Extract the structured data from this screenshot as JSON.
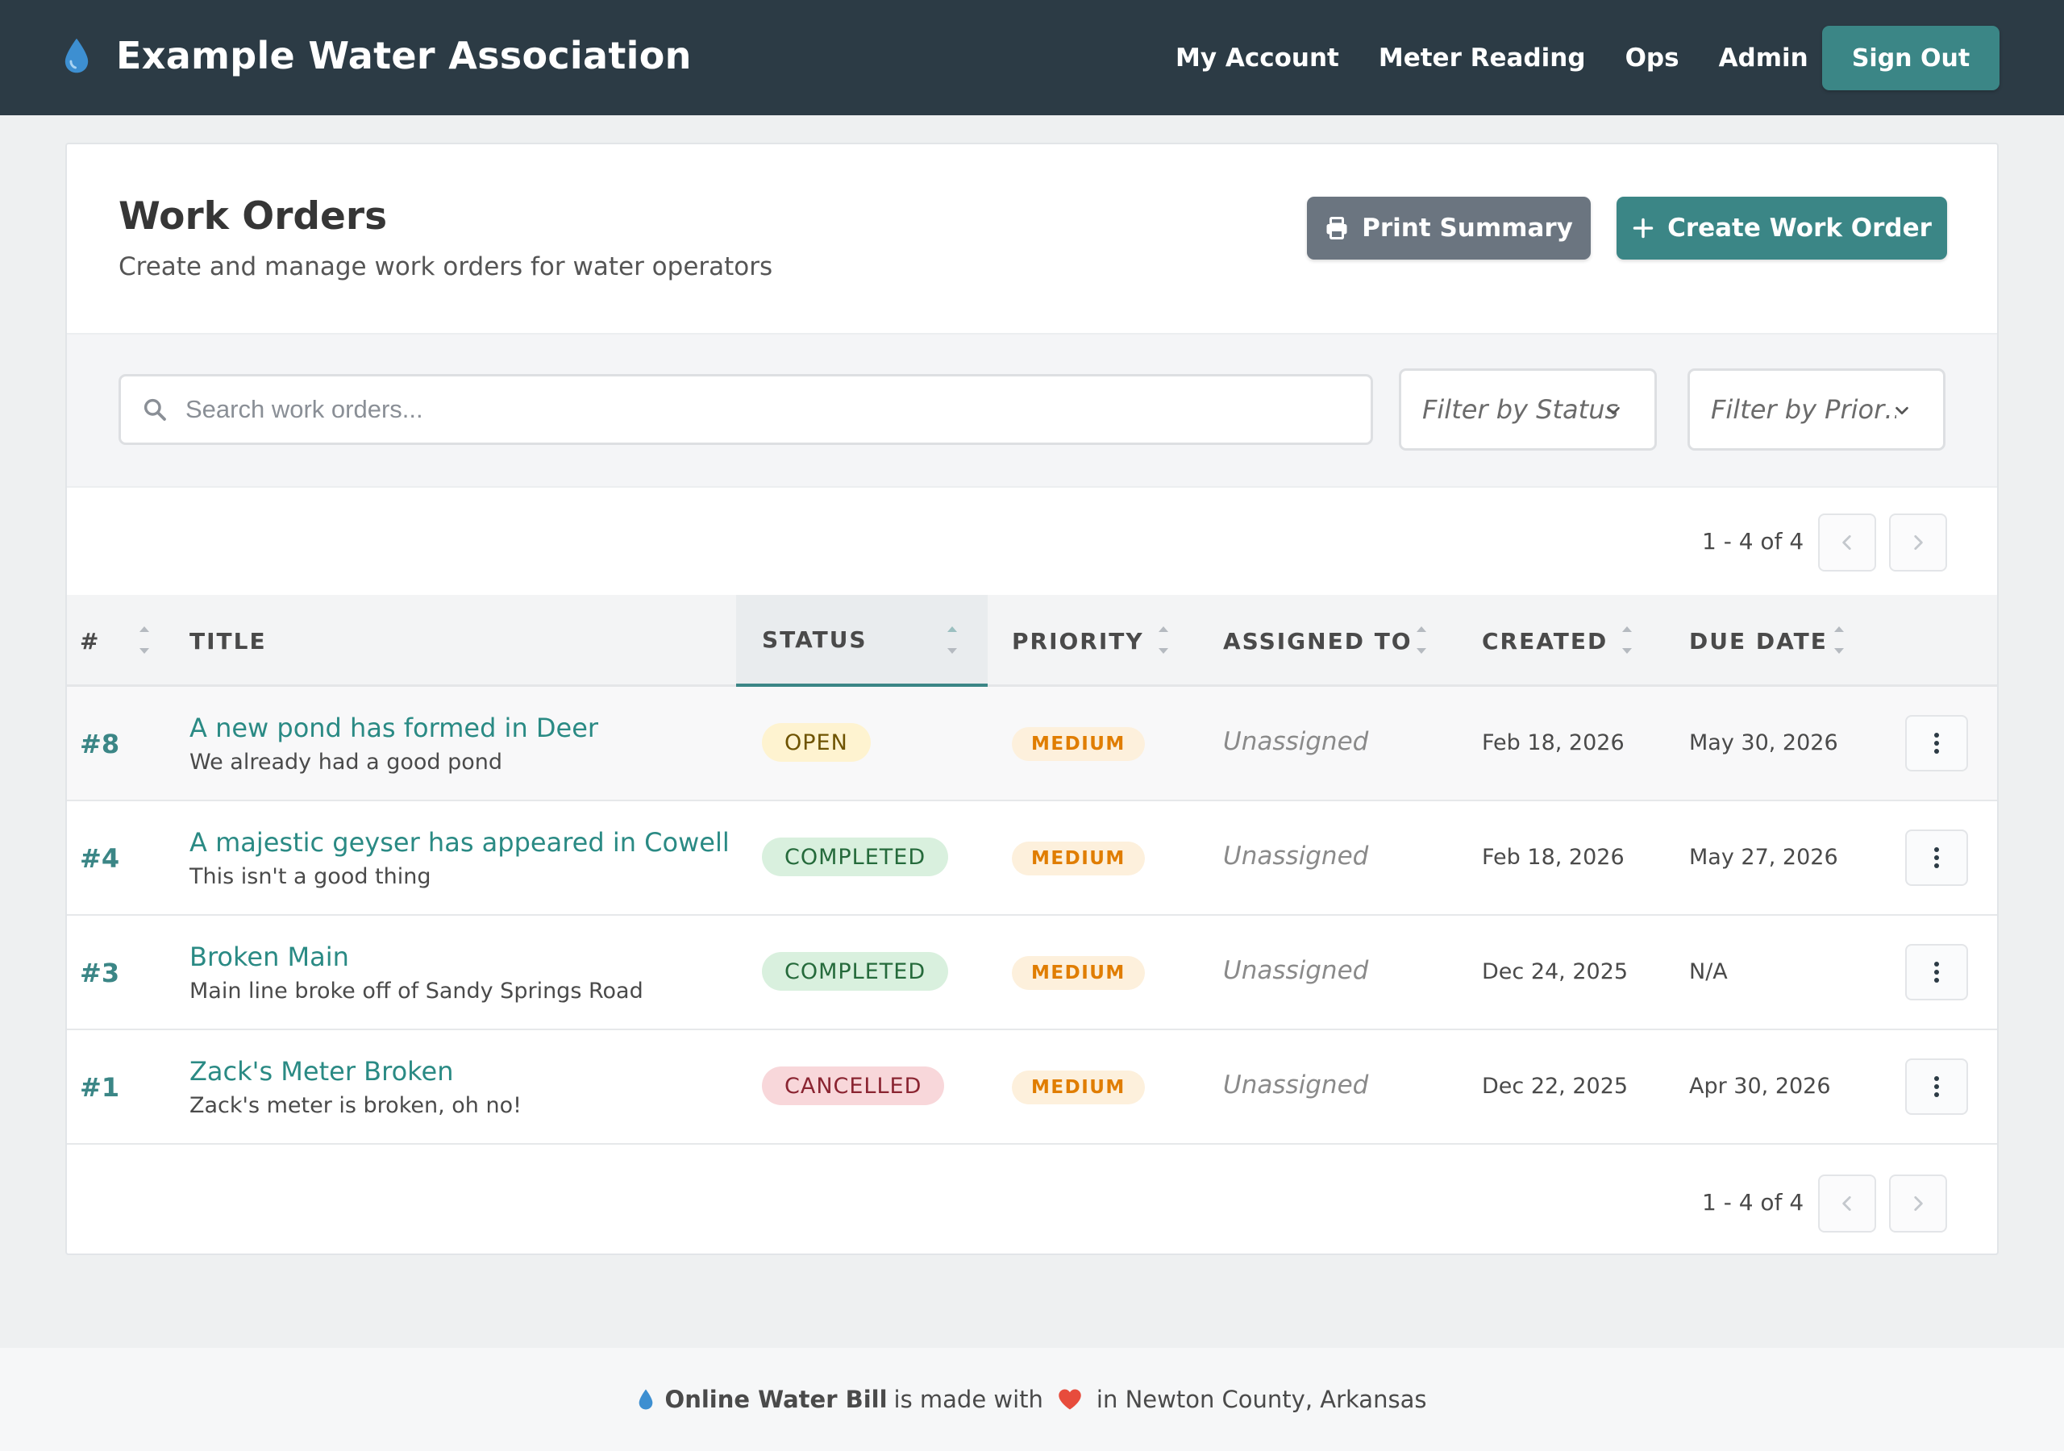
{
  "navbar": {
    "brand_title": "Example Water Association",
    "links": [
      {
        "label": "My Account"
      },
      {
        "label": "Meter Reading"
      },
      {
        "label": "Ops"
      },
      {
        "label": "Admin"
      }
    ],
    "signout_label": "Sign Out"
  },
  "page": {
    "title": "Work Orders",
    "subtitle": "Create and manage work orders for water operators",
    "print_label": "Print Summary",
    "create_label": "Create Work Order"
  },
  "filters": {
    "search_placeholder": "Search work orders...",
    "status_placeholder": "Filter by Status",
    "priority_placeholder": "Filter by Prior…"
  },
  "pagination": {
    "range_text": "1 - 4 of 4"
  },
  "table": {
    "headers": {
      "id": "#",
      "title": "TITLE",
      "status": "STATUS",
      "priority": "PRIORITY",
      "assigned": "ASSIGNED TO",
      "created": "CREATED",
      "due": "DUE DATE"
    },
    "rows": [
      {
        "id": "#8",
        "title": "A new pond has formed in Deer",
        "description": "We already had a good pond",
        "status": "OPEN",
        "priority": "MEDIUM",
        "assigned": "Unassigned",
        "created": "Feb 18, 2026",
        "due": "May 30, 2026"
      },
      {
        "id": "#4",
        "title": "A majestic geyser has appeared in Cowell",
        "description": "This isn't a good thing",
        "status": "COMPLETED",
        "priority": "MEDIUM",
        "assigned": "Unassigned",
        "created": "Feb 18, 2026",
        "due": "May 27, 2026"
      },
      {
        "id": "#3",
        "title": "Broken Main",
        "description": "Main line broke off of Sandy Springs Road",
        "status": "COMPLETED",
        "priority": "MEDIUM",
        "assigned": "Unassigned",
        "created": "Dec 24, 2025",
        "due": "N/A"
      },
      {
        "id": "#1",
        "title": "Zack's Meter Broken",
        "description": "Zack's meter is broken, oh no!",
        "status": "CANCELLED",
        "priority": "MEDIUM",
        "assigned": "Unassigned",
        "created": "Dec 22, 2025",
        "due": "Apr 30, 2026"
      }
    ]
  },
  "footer": {
    "brand": "Online Water Bill",
    "made_with": "is made with",
    "location": "in Newton County, Arkansas"
  },
  "colors": {
    "navbar": "#2c3b45",
    "accent": "#3b8686",
    "secondary_button": "#6b7580",
    "heart": "#e74c3c",
    "drop": "#3d8fd1"
  },
  "icons": {
    "brand": "water-drop-icon",
    "print": "printer-icon",
    "create": "plus-icon",
    "search": "search-icon",
    "menu": "kebab-menu-icon",
    "footer_heart": "heart-icon"
  }
}
